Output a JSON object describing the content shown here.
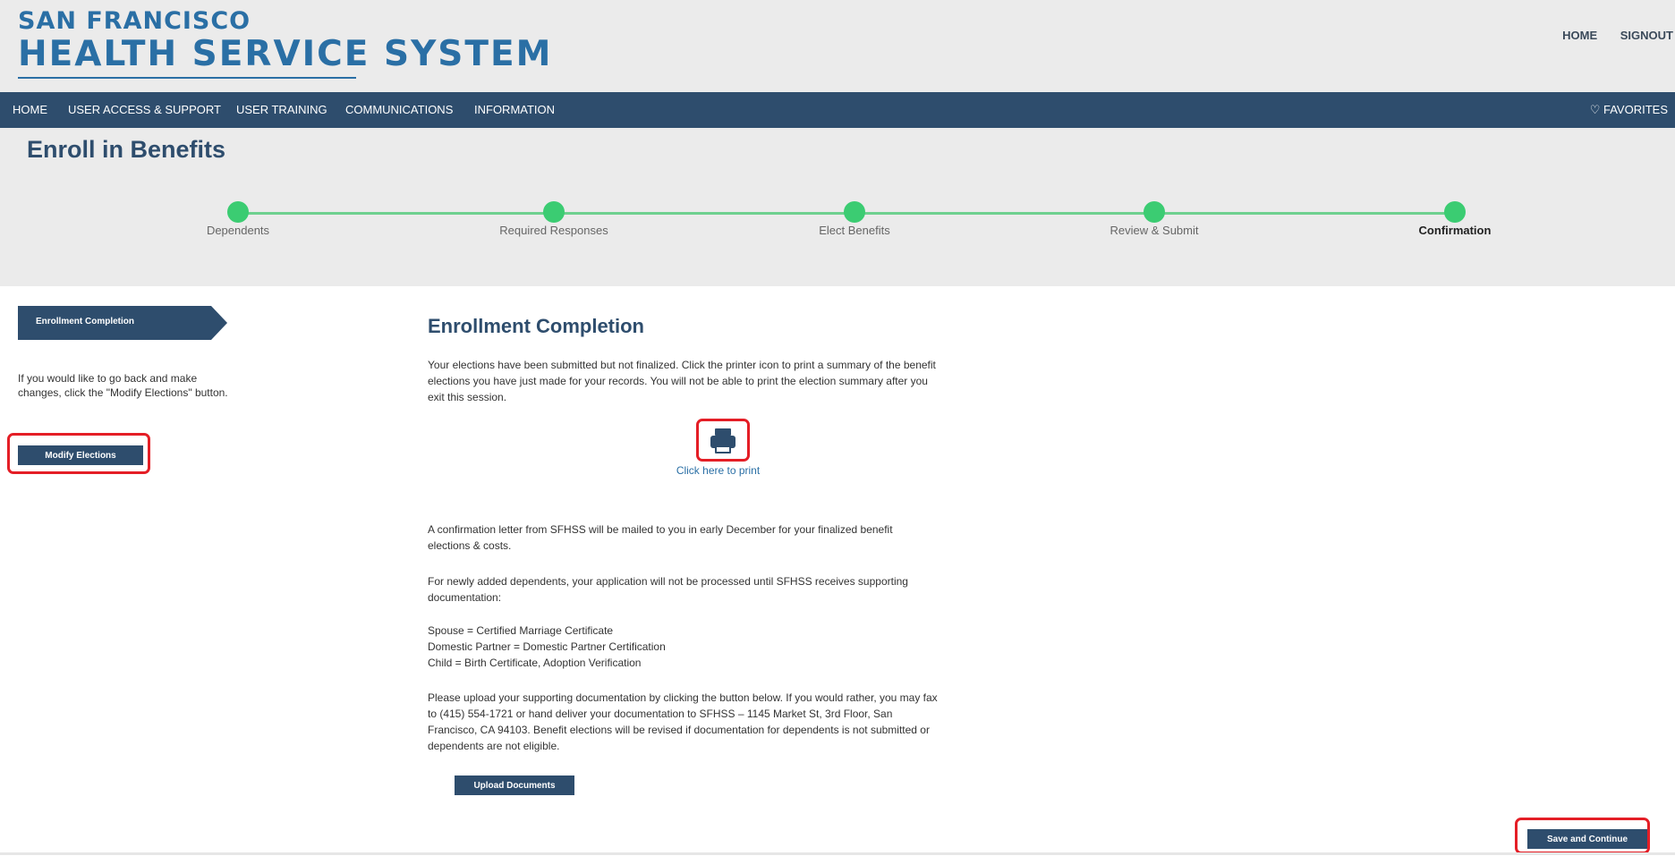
{
  "header": {
    "logo_line1": "SAN FRANCISCO",
    "logo_line2": "HEALTH SERVICE SYSTEM",
    "links": [
      "HOME",
      "SIGNOUT"
    ]
  },
  "nav": {
    "items": [
      "HOME",
      "USER ACCESS & SUPPORT",
      "USER TRAINING",
      "COMMUNICATIONS",
      "INFORMATION"
    ],
    "favorites": "♡ FAVORITES"
  },
  "page": {
    "title": "Enroll in Benefits"
  },
  "steps": [
    {
      "label": "Dependents",
      "active": false
    },
    {
      "label": "Required Responses",
      "active": false
    },
    {
      "label": "Elect Benefits",
      "active": false
    },
    {
      "label": "Review & Submit",
      "active": false
    },
    {
      "label": "Confirmation",
      "active": true
    }
  ],
  "sidebar": {
    "tab_label": "Enrollment Completion",
    "help_text": "If you would like to go back and make changes, click the \"Modify Elections\" button.",
    "modify_button": "Modify Elections"
  },
  "main": {
    "title": "Enrollment Completion",
    "intro": "Your elections have been submitted but not finalized. Click the printer icon to print a summary of the benefit elections you have just made for your records. You will not be able to print the election summary after you exit this session.",
    "print_label": "Click here to print",
    "confirmation_note": "A confirmation letter from SFHSS will be mailed to you in early December for your finalized benefit elections & costs.",
    "dependents_note": "For newly added dependents, your application will not be processed until SFHSS receives supporting documentation:",
    "doc_lines": [
      "Spouse = Certified Marriage Certificate",
      "Domestic Partner = Domestic Partner Certification",
      "Child = Birth Certificate, Adoption Verification"
    ],
    "upload_note": "Please upload your supporting documentation by clicking the button below. If you would rather, you may fax to (415) 554-1721 or hand deliver your documentation to SFHSS – 1145 Market St, 3rd Floor, San Francisco, CA 94103. Benefit elections will be revised if documentation for dependents is not submitted or dependents are not eligible.",
    "upload_button": "Upload Documents"
  },
  "footer": {
    "save_button": "Save and Continue"
  },
  "colors": {
    "brand_blue": "#2a6fa5",
    "nav_navy": "#2e4d6d",
    "step_green": "#3bcc72",
    "highlight_red": "#e41e26"
  }
}
